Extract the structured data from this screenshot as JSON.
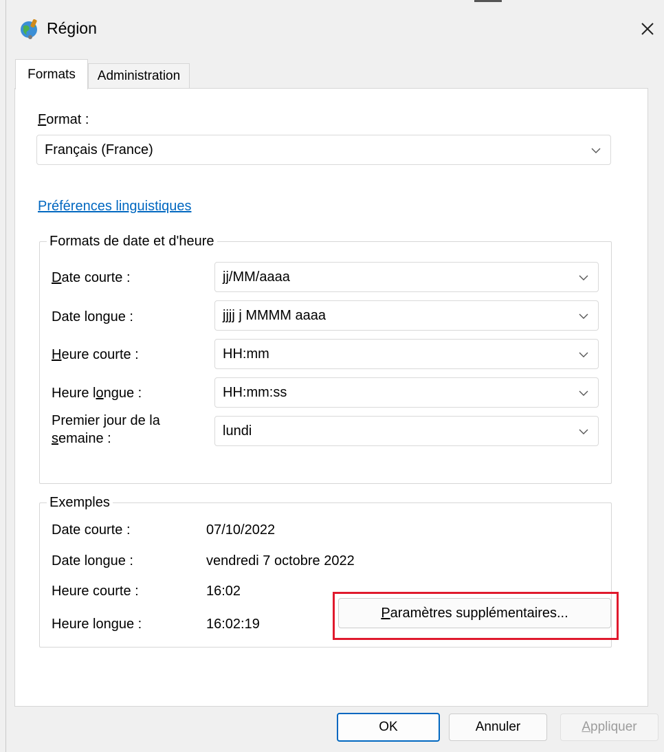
{
  "window": {
    "title": "Région",
    "icon": "globe-icon",
    "close_icon": "close-icon"
  },
  "tabs": [
    {
      "label": "Formats",
      "active": true
    },
    {
      "label": "Administration",
      "active": false
    }
  ],
  "format": {
    "label_accel": "F",
    "label_rest": "ormat :",
    "selected": "Français (France)"
  },
  "language_link": "Préférences linguistiques",
  "date_time_group": {
    "legend": "Formats de date et d'heure",
    "rows": [
      {
        "label_pre": "",
        "label_accel": "D",
        "label_post": "ate courte :",
        "value": "jj/MM/aaaa"
      },
      {
        "label_pre": "Date longue :",
        "label_accel": "",
        "label_post": "",
        "value": "jjjj j MMMM aaaa"
      },
      {
        "label_pre": "",
        "label_accel": "H",
        "label_post": "eure courte :",
        "value": "HH:mm"
      },
      {
        "label_pre": "Heure l",
        "label_accel": "o",
        "label_post": "ngue :",
        "value": "HH:mm:ss"
      }
    ],
    "first_day": {
      "label_line1": "Premier jour de la",
      "label_accel": "s",
      "label_line2_rest": "emaine :",
      "value": "lundi"
    }
  },
  "examples": {
    "legend": "Exemples",
    "rows": [
      {
        "label": "Date courte :",
        "value": "07/10/2022"
      },
      {
        "label": "Date longue :",
        "value": "vendredi 7 octobre 2022"
      },
      {
        "label": "Heure courte :",
        "value": "16:02"
      },
      {
        "label": "Heure longue :",
        "value": "16:02:19"
      }
    ]
  },
  "additional_settings": {
    "accel": "P",
    "rest": "aramètres supplémentaires..."
  },
  "footer": {
    "ok": "OK",
    "cancel": "Annuler",
    "apply_accel": "A",
    "apply_rest": "ppliquer"
  },
  "colors": {
    "link": "#0067c0",
    "highlight": "#e0192d",
    "primary_border": "#0067c0"
  }
}
